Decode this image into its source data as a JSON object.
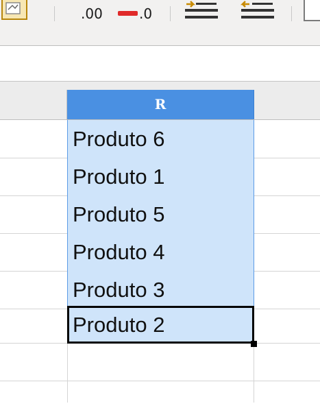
{
  "toolbar": {
    "decimal_add_label": ".00",
    "decimal_remove_label": ".0"
  },
  "sheet": {
    "column_header": "R",
    "cells": [
      "Produto 6",
      "Produto 1",
      "Produto 5",
      "Produto 4",
      "Produto 3",
      "Produto 2"
    ],
    "active_cell_index": 5
  },
  "colors": {
    "selection_header": "#4a90e2",
    "selection_fill": "#cfe4fa",
    "decrease_decimal_icon": "#e02a2a"
  }
}
